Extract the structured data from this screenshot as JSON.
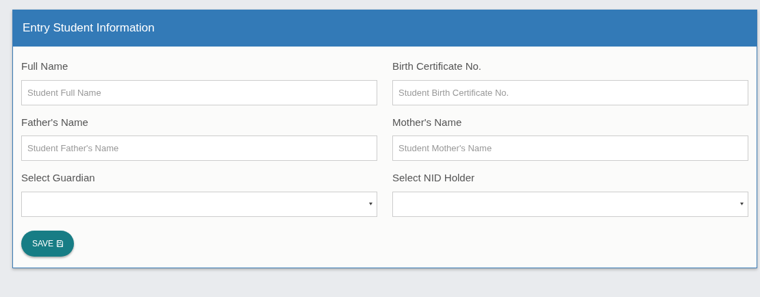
{
  "panel": {
    "title": "Entry Student Information"
  },
  "fields": [
    {
      "label": "Full Name",
      "kind": "text",
      "placeholder": "Student Full Name"
    },
    {
      "label": "Birth Certificate No.",
      "kind": "text",
      "placeholder": "Student Birth Certificate No."
    },
    {
      "label": "Father's Name",
      "kind": "text",
      "placeholder": "Student Father's Name"
    },
    {
      "label": "Mother's Name",
      "kind": "text",
      "placeholder": "Student Mother's Name"
    },
    {
      "label": "Select Guardian",
      "kind": "select"
    },
    {
      "label": "Select NID Holder",
      "kind": "select"
    }
  ],
  "save_button": {
    "label": "SAVE"
  }
}
